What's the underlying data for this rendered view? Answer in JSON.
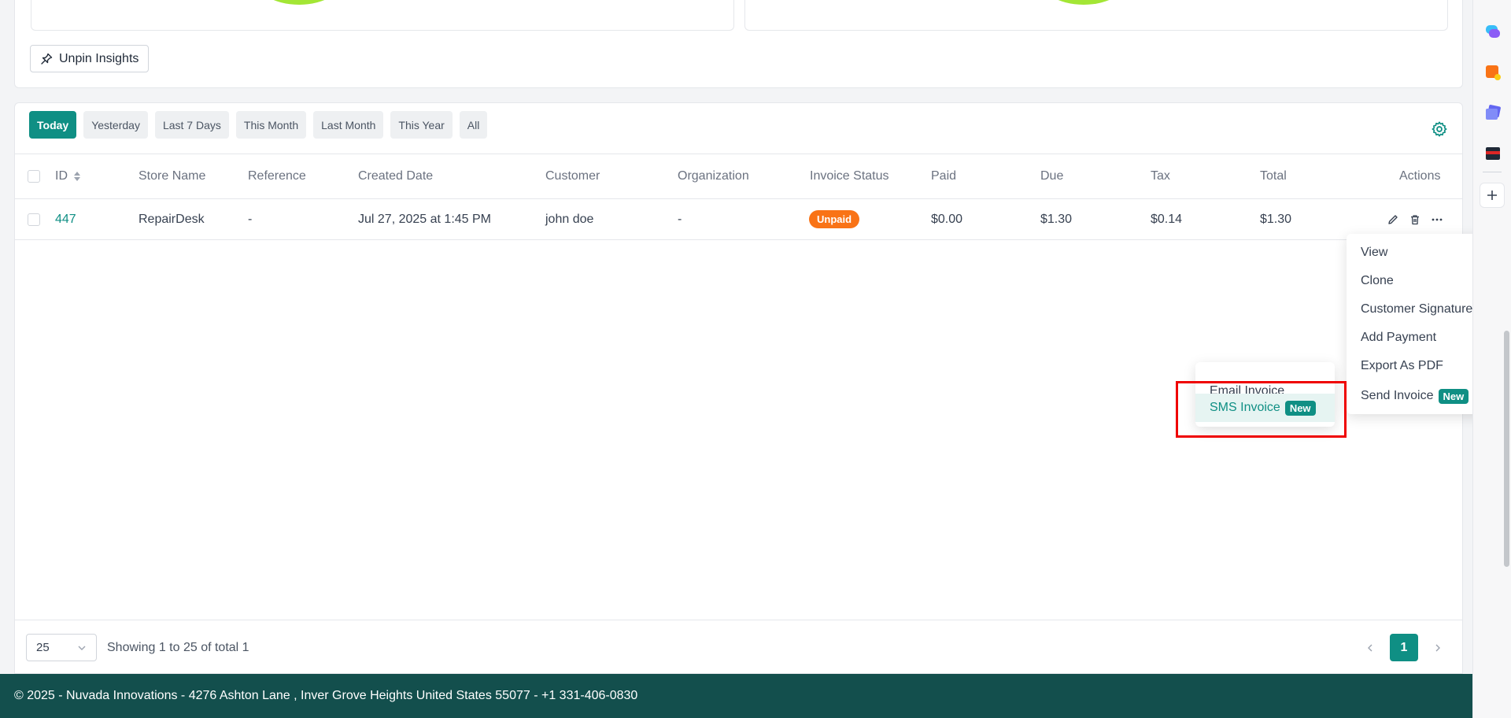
{
  "insights": {
    "unpin_label": "Unpin Insights"
  },
  "filters": [
    {
      "label": "Today",
      "active": true
    },
    {
      "label": "Yesterday",
      "active": false
    },
    {
      "label": "Last 7 Days",
      "active": false
    },
    {
      "label": "This Month",
      "active": false
    },
    {
      "label": "Last Month",
      "active": false
    },
    {
      "label": "This Year",
      "active": false
    },
    {
      "label": "All",
      "active": false
    }
  ],
  "table": {
    "headers": {
      "id": "ID",
      "store": "Store Name",
      "reference": "Reference",
      "created": "Created Date",
      "customer": "Customer",
      "organization": "Organization",
      "status": "Invoice Status",
      "paid": "Paid",
      "due": "Due",
      "tax": "Tax",
      "total": "Total",
      "actions": "Actions"
    },
    "rows": [
      {
        "id": "447",
        "store": "RepairDesk",
        "reference": "-",
        "created": "Jul 27, 2025 at 1:45 PM",
        "customer": "john doe",
        "organization": "-",
        "status": "Unpaid",
        "paid": "$0.00",
        "due": "$1.30",
        "tax": "$0.14",
        "total": "$1.30"
      }
    ]
  },
  "dropdown": {
    "items": [
      "View",
      "Clone",
      "Customer Signature",
      "Add Payment",
      "Export As PDF"
    ],
    "send_invoice": "Send Invoice",
    "new_badge": "New"
  },
  "submenu": {
    "email": "Email Invoice",
    "sms": "SMS Invoice",
    "new_badge": "New"
  },
  "pagination": {
    "page_size": "25",
    "showing": "Showing 1 to 25 of total 1",
    "current_page": "1"
  },
  "footer": {
    "text": "© 2025 - Nuvada Innovations - 4276 Ashton Lane , Inver Grove Heights United States 55077 - +1 331-406-0830"
  },
  "colors": {
    "accent": "#0f8f84",
    "unpaid": "#f97316",
    "footer_bg": "#134f4d",
    "highlight": "#ef0000"
  },
  "rail_icons": [
    "chat-icon",
    "notes-icon",
    "cards-icon",
    "wallet-icon"
  ]
}
